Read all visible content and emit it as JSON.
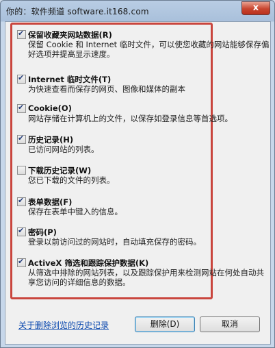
{
  "window": {
    "title": "你的：软件频道 software.it168.com",
    "close_glyph": "x"
  },
  "items": [
    {
      "label": "保留收藏夹网站数据(R)",
      "checked": true,
      "desc": "保留 Cookie 和 Internet 临时文件，可以使您收藏的网站能够保存偏好选项并提高显示速度。"
    },
    {
      "label": "Internet 临时文件(T)",
      "checked": true,
      "desc": "为快速查看而保存的网页、图像和媒体的副本"
    },
    {
      "label": "Cookie(O)",
      "checked": true,
      "desc": "网站存储在计算机上的文件，以保存如登录信息等首选项。"
    },
    {
      "label": "历史记录(H)",
      "checked": true,
      "desc": "已访问网站的列表。"
    },
    {
      "label": "下载历史记录(W)",
      "checked": false,
      "desc": "您已下载的文件的列表。"
    },
    {
      "label": "表单数据(F)",
      "checked": true,
      "desc": "保存在表单中键入的信息。"
    },
    {
      "label": "密码(P)",
      "checked": true,
      "desc": "登录以前访问过的网站时，自动填充保存的密码。"
    },
    {
      "label": "ActiveX 筛选和跟踪保护数据(K)",
      "checked": true,
      "desc": "从筛选中排除的网站列表，以及跟踪保护用来检测网站在何处自动共享您访问的详细信息的数据。"
    }
  ],
  "footer": {
    "link": "关于删除浏览的历史记录",
    "delete_button": "删除(D)",
    "cancel_button": "取消"
  },
  "colors": {
    "highlight_border": "#c9453d",
    "link": "#0645ad"
  }
}
